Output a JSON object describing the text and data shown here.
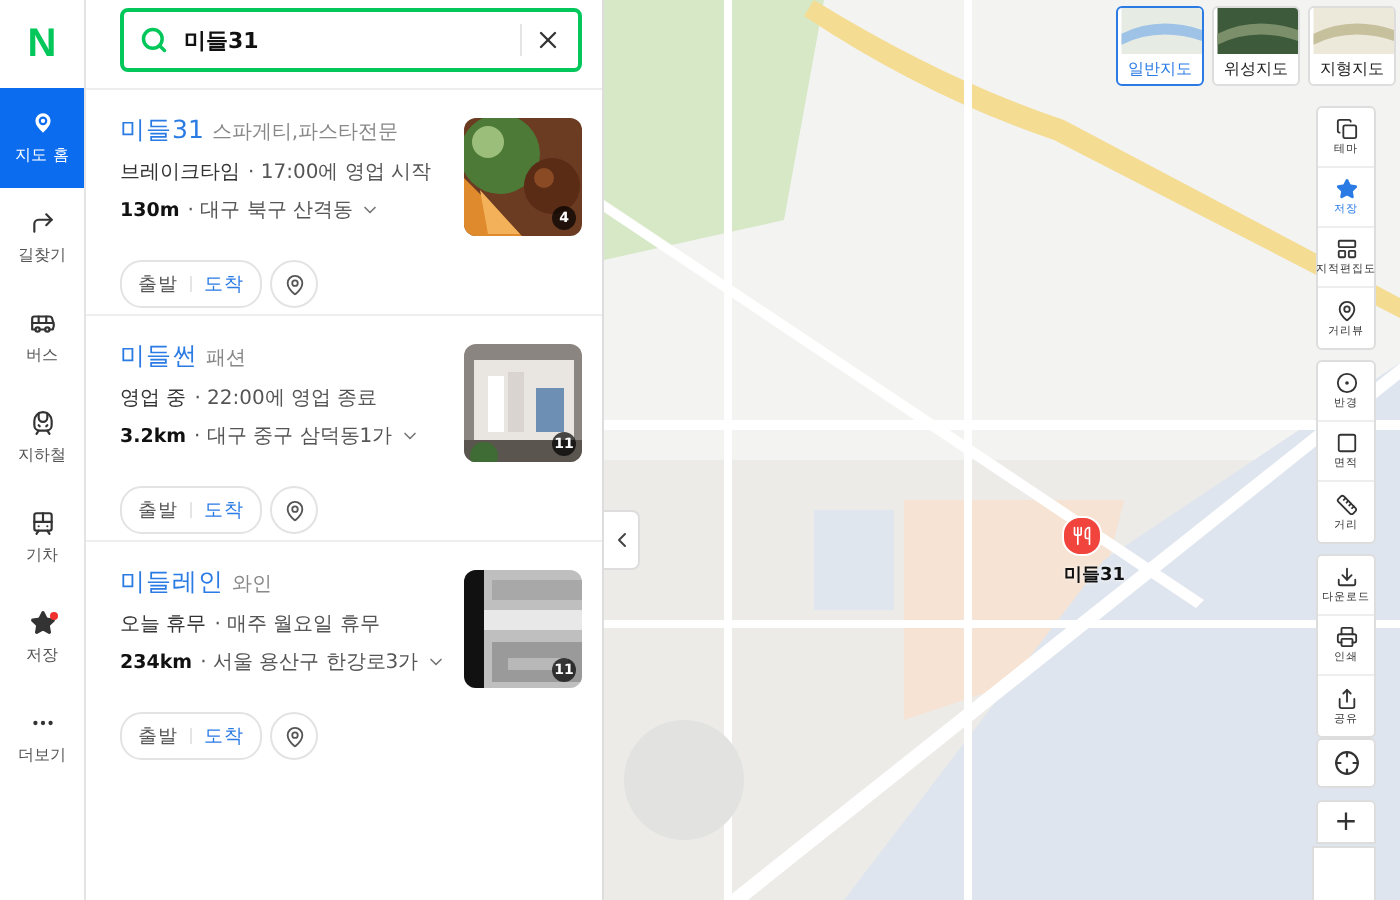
{
  "logo": "N",
  "sidebar": {
    "items": [
      {
        "kind": "home",
        "label": "지도 홈",
        "selected": true,
        "notice": false
      },
      {
        "kind": "route",
        "label": "길찾기",
        "selected": false,
        "notice": false
      },
      {
        "kind": "bus",
        "label": "버스",
        "selected": false,
        "notice": false
      },
      {
        "kind": "subway",
        "label": "지하철",
        "selected": false,
        "notice": false
      },
      {
        "kind": "train",
        "label": "기차",
        "selected": false,
        "notice": false
      },
      {
        "kind": "saved",
        "label": "저장",
        "selected": false,
        "notice": true
      },
      {
        "kind": "more",
        "label": "더보기",
        "selected": false,
        "notice": false
      }
    ]
  },
  "search": {
    "value": "미들31"
  },
  "results": [
    {
      "name": "미들31",
      "category": "스파게티,파스타전문",
      "status": "브레이크타임",
      "hours": "· 17:00에 영업 시작",
      "distance": "130m",
      "address": "· 대구 북구 산격동",
      "photo_count": "4",
      "actions": [
        "출발",
        "도착"
      ]
    },
    {
      "name": "미들썬",
      "category": "패션",
      "status": "영업 중",
      "hours": "· 22:00에 영업 종료",
      "distance": "3.2km",
      "address": "· 대구 중구 삼덕동1가",
      "photo_count": "11",
      "actions": [
        "출발",
        "도착"
      ]
    },
    {
      "name": "미들레인",
      "category": "와인",
      "status": "오늘 휴무",
      "hours": "· 매주 월요일 휴무",
      "distance": "234km",
      "address": "· 서울 용산구 한강로3가",
      "photo_count": "11",
      "actions": [
        "출발",
        "도착"
      ]
    }
  ],
  "map": {
    "kind": "picture",
    "marker": {
      "label": "미들31"
    },
    "map_types": [
      {
        "kind": "normal",
        "label": "일반지도",
        "selected": true
      },
      {
        "kind": "satellite",
        "label": "위성지도",
        "selected": false
      },
      {
        "kind": "terrain",
        "label": "지형지도",
        "selected": false
      }
    ],
    "tool_groups": [
      [
        {
          "kind": "theme",
          "label": "테마",
          "selected": false
        },
        {
          "kind": "save",
          "label": "저장",
          "selected": true
        },
        {
          "kind": "cadastral",
          "label": "지적편집도",
          "selected": false
        },
        {
          "kind": "street",
          "label": "거리뷰",
          "selected": false
        }
      ],
      [
        {
          "kind": "radius",
          "label": "반경",
          "selected": false
        },
        {
          "kind": "area",
          "label": "면적",
          "selected": false
        },
        {
          "kind": "distance",
          "label": "거리",
          "selected": false
        }
      ],
      [
        {
          "kind": "download",
          "label": "다운로드",
          "selected": false
        },
        {
          "kind": "print",
          "label": "인쇄",
          "selected": false
        },
        {
          "kind": "share",
          "label": "공유",
          "selected": false
        }
      ]
    ],
    "zoom_in": "+"
  }
}
